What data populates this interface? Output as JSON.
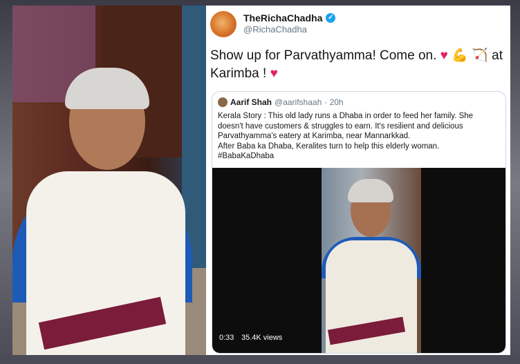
{
  "tweet": {
    "display_name": "TheRichaChadha",
    "handle": "@RichaChadha",
    "text_line1": "Show up for Parvathyamma! Come on.",
    "text_line1_tail": "at",
    "text_line2": "Karimba !"
  },
  "quoted_tweet": {
    "display_name": "Aarif Shah",
    "handle": "@aarifshaah",
    "time": "· 20h",
    "lines": [
      "Kerala Story : This old lady runs a Dhaba in order to feed her family. She",
      "doesn't have customers & struggles to earn. It's resilient and delicious",
      "Parvathyamma's eatery at Karimba, near Mannarkkad.",
      "After Baba ka Dhaba, Keralites turn to help this elderly woman.",
      "#BabaKaDhaba"
    ],
    "video": {
      "duration": "0:33",
      "views": "35.4K views"
    }
  },
  "icons": {
    "verified": "verified-badge-icon",
    "heart": "heart-icon",
    "flexed_bicep": "flexed-biceps-icon",
    "bow_arrow": "bow-and-arrow-icon"
  },
  "colors": {
    "verified_blue": "#1da1f2",
    "heart_red": "#e0245e",
    "text_dark": "#14171a",
    "text_muted": "#657786"
  }
}
